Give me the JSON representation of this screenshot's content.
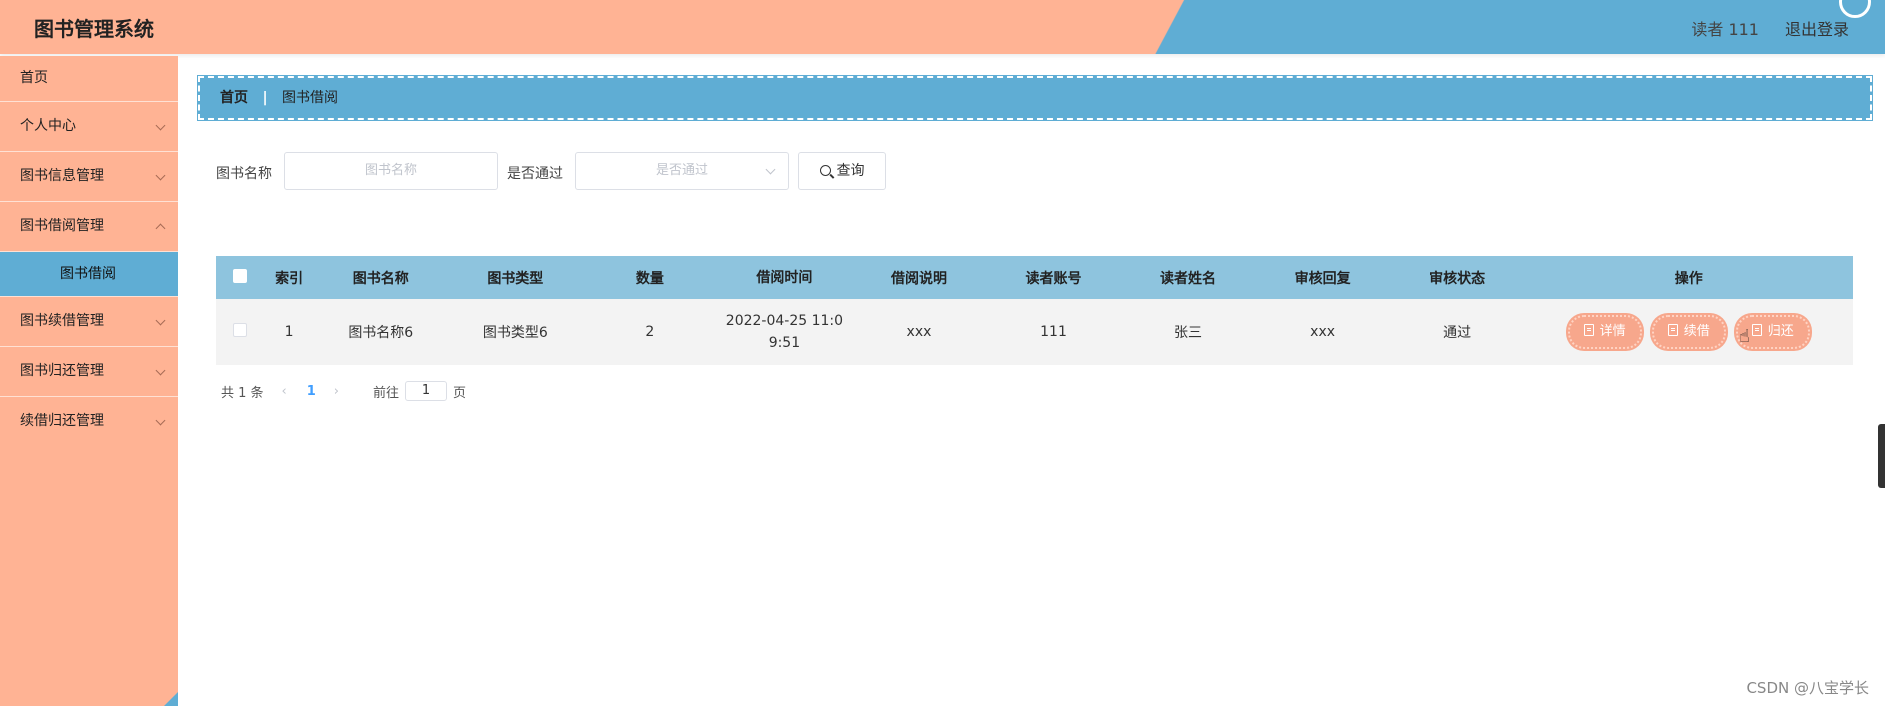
{
  "header": {
    "title": "图书管理系统",
    "user": "读者 111",
    "logout": "退出登录"
  },
  "sidebar": {
    "items": [
      {
        "label": "首页"
      },
      {
        "label": "个人中心"
      },
      {
        "label": "图书信息管理"
      },
      {
        "label": "图书借阅管理"
      },
      {
        "label": "图书借阅"
      },
      {
        "label": "图书续借管理"
      },
      {
        "label": "图书归还管理"
      },
      {
        "label": "续借归还管理"
      }
    ]
  },
  "breadcrumb": {
    "home": "首页",
    "separator": "|",
    "current": "图书借阅"
  },
  "search": {
    "book_name_label": "图书名称",
    "book_name_placeholder": "图书名称",
    "approved_label": "是否通过",
    "approved_placeholder": "是否通过",
    "query_label": "查询"
  },
  "table": {
    "headers": [
      "索引",
      "图书名称",
      "图书类型",
      "数量",
      "借阅时间",
      "借阅说明",
      "读者账号",
      "读者姓名",
      "审核回复",
      "审核状态",
      "操作"
    ],
    "rows": [
      {
        "index": "1",
        "book_name": "图书名称6",
        "book_type": "图书类型6",
        "quantity": "2",
        "borrow_time_line1": "2022-04-25 11:0",
        "borrow_time_line2": "9:51",
        "description": "xxx",
        "reader_account": "111",
        "reader_name": "张三",
        "review_reply": "xxx",
        "review_status": "通过",
        "actions": [
          "详情",
          "续借",
          "归还"
        ]
      }
    ]
  },
  "pagination": {
    "total": "共 1 条",
    "prev": "‹",
    "current_page": "1",
    "next": "›",
    "goto_label": "前往",
    "goto_value": "1",
    "page_suffix": "页"
  },
  "watermark": "CSDN @八宝学长",
  "colors": {
    "header_left": "#ffb394",
    "header_right": "#5fadd4",
    "sidebar": "#ffb394",
    "active_item": "#5fadd4",
    "table_header": "#8ec4de",
    "action_button": "#f7a78c"
  }
}
